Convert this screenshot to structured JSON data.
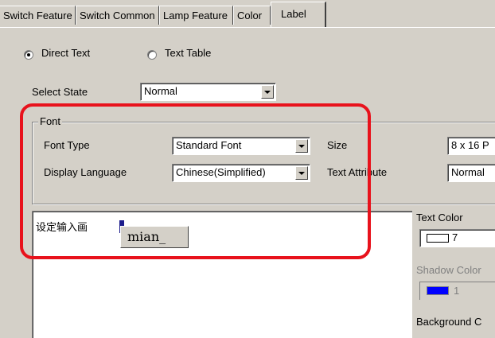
{
  "tabs": [
    {
      "label": "Switch Feature",
      "active": false
    },
    {
      "label": "Switch Common",
      "active": false
    },
    {
      "label": "Lamp Feature",
      "active": false
    },
    {
      "label": "Color",
      "active": false
    },
    {
      "label": "Label",
      "active": true
    }
  ],
  "text_source": {
    "direct_text": {
      "label": "Direct Text",
      "selected": true
    },
    "text_table": {
      "label": "Text Table",
      "selected": false
    }
  },
  "select_state": {
    "label": "Select State",
    "value": "Normal"
  },
  "font": {
    "group_title": "Font",
    "font_type": {
      "label": "Font Type",
      "value": "Standard Font"
    },
    "size": {
      "label": "Size",
      "value": "8 x 16 P"
    },
    "display_language": {
      "label": "Display Language",
      "value": "Chinese(Simplified)"
    },
    "text_attribute": {
      "label": "Text Attribute",
      "value": "Normal"
    }
  },
  "preview": {
    "text": "设定输入画",
    "ime_composition": "mian_"
  },
  "text_color": {
    "label": "Text Color",
    "value": "7",
    "swatch_color": "#ffffff"
  },
  "shadow_color": {
    "label": "Shadow Color",
    "value": "1",
    "swatch_color": "#0000ff"
  },
  "background_color": {
    "label": "Background C"
  },
  "colors": {
    "window_bg": "#d4d0c8",
    "highlight": "#e8121c",
    "cursor": "#1c1c8c"
  }
}
